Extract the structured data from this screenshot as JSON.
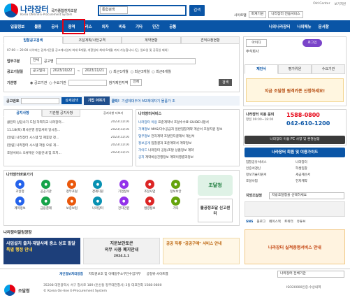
{
  "header": {
    "logo_title": "나라장터",
    "logo_title_sub": "국가종합전자조달",
    "logo_sub": "Korea ON-line E-Procurement System",
    "search_select": "통합검색",
    "search_button": "검색",
    "top_links": [
      "Old Center",
      "보기지원"
    ],
    "site_select_label": "사이트맵",
    "site_select": "회계기원",
    "site_select2": "나라장터 전용서비스"
  },
  "nav": {
    "items": [
      "입찰정보",
      "물품",
      "공사",
      "용역",
      "리스",
      "외자",
      "비축",
      "기타",
      "민간",
      "공통"
    ],
    "right": [
      "나의나라장터",
      "나의메뉴",
      "문서함"
    ]
  },
  "bid": {
    "title": "입찰공고검색",
    "tabs": [
      "입찰공고검색",
      "조달계획/사전규격",
      "계약현황",
      "견적요청현황"
    ],
    "notice": "07:00 ~ 20:00 사이에는 검색기간을 공고게시일자 최대 6개월, 개찰일자 최대 6개월 까지 가능합니다.(단, 일요일 및 공휴일 제외)",
    "biz_label": "업무구분",
    "biz_value": "전체",
    "name_label": "공고명",
    "date_label": "공고기일일",
    "date_type": "공고일자",
    "date_from": "2023/10/22",
    "date_to": "2023/11/21",
    "period_opts": [
      "최근1개월",
      "최근3개월",
      "최근6개월"
    ],
    "org_label": "기관명",
    "org_opts": [
      "공고기관",
      "수요기관"
    ],
    "region_label": "참가제한지역",
    "region_value": "전체",
    "search": "검색"
  },
  "notice": {
    "label": "공고번호",
    "placeholder": "",
    "detail_btn": "상세검색",
    "banner_a": "기업 이야기",
    "banner_b": "클릭!",
    "banner_c": "기설제대두어 M2제대자기 물품가 조"
  },
  "news": {
    "tabs": [
      "공지사항",
      "기관별 공지사항"
    ],
    "more": "공지사항 더보기",
    "items": [
      {
        "t": "클린터 상담사가 도업 하역하고 나라장터...",
        "d": "2023/11/16"
      },
      {
        "t": "11.18(토) 회사운영 중앙서버 일시중...",
        "d": "2023/11/16"
      },
      {
        "t": "[알림] 나라장터 시스템 및 제휴망 정...",
        "d": "2023/11/16"
      },
      {
        "t": "[알림] 나라장터 시스템 작동 오류 개...",
        "d": "2023/11/16"
      },
      {
        "t": "조달서비스 오류개선 이용안내 및 조치...",
        "d": "2023/11/15"
      }
    ]
  },
  "service": {
    "title": "나라장터서비스",
    "items": [
      {
        "a": "나라장터 이용",
        "b": "표준계약서 조달수수료 GUIDE사항서"
      },
      {
        "a": "가격정보",
        "b": "MAS/다수공급자 일반입찰계약 계산서 조달지원 정보"
      },
      {
        "a": "업무정보",
        "b": "전자계약 조달전자결제서 계산서"
      },
      {
        "a": "정보공개",
        "b": "입찰결과 표준계약서 계약정보"
      },
      {
        "a": "가이드",
        "b": "나라장터 공동/조달 상품정보 계약"
      },
      {
        "a": "공지",
        "b": "계약비용진행정보 계약이행결과정보"
      }
    ]
  },
  "quick": {
    "title": "나라장터바로가기",
    "items": [
      "조달청",
      "공공기관",
      "정부포털",
      "경제지원",
      "기업정보",
      "조달사업",
      "정보보안",
      "계약정보",
      "금융결제",
      "보증보험",
      "나라장터",
      "전자민원",
      "법령정보",
      "기타"
    ],
    "mascot": "조달청",
    "right_title": "불공정조달 신고센터"
  },
  "promo": {
    "title": "나라장터알림광장",
    "a": "사업설치 출처·재발사례 중소 상호 발달",
    "a2": "특별 행정 안내",
    "b": "지문보안토큰",
    "b2": "의무 사용 폐지안내",
    "b3": "2024.1.1",
    "c": "공공 직류 \"공공구매\" 서비스 안내",
    "d": "나라장터 실적증명서비스 안내"
  },
  "login": {
    "id_label": "아이디",
    "id_value": "주식회사",
    "label2": "로그인",
    "tabs": [
      "제안서",
      "평가위원",
      "수요기관"
    ],
    "side_label": "공고확인",
    "cert": "지금 조달청 원격카폰 신청하세요!"
  },
  "help": {
    "title": "나라장터 이용 문의",
    "phone1": "1588-0800",
    "phone2": "042-610-1200",
    "hours": "평일 09:00~18:00",
    "pc_btn": "나라장터 이용 PC 사양 및 환경설정",
    "guide_btn": "나라장터 회원 및 이용가이드"
  },
  "links": {
    "items": [
      "입찰공유서비스",
      "나라장터",
      "인증서갱신",
      "학생입찰",
      "정보기술지원서",
      "세금계산서",
      "조달사업",
      "전자계약"
    ]
  },
  "region": {
    "label": "지방조달청",
    "select": "지방조달청을 선택하세요"
  },
  "sns": {
    "label": "SNS",
    "items": [
      "블로그",
      "페이스북",
      "트위터",
      "유튜브"
    ]
  },
  "footer": {
    "select": "나라장터 전체기관",
    "links": [
      "개인정보처리방침",
      "저작권보호 및 이메일주소무단수집거부",
      "공정위·사이트맵"
    ],
    "addr": "35208 대전광역시 서구 청사로 189 (둔산동 정부대전청사) 3동 대표전화 1588-0800",
    "copy": "© Korea On-line E-Procurement System",
    "brand": "조달청",
    "iso": "ISO20000인증·수상내역"
  }
}
